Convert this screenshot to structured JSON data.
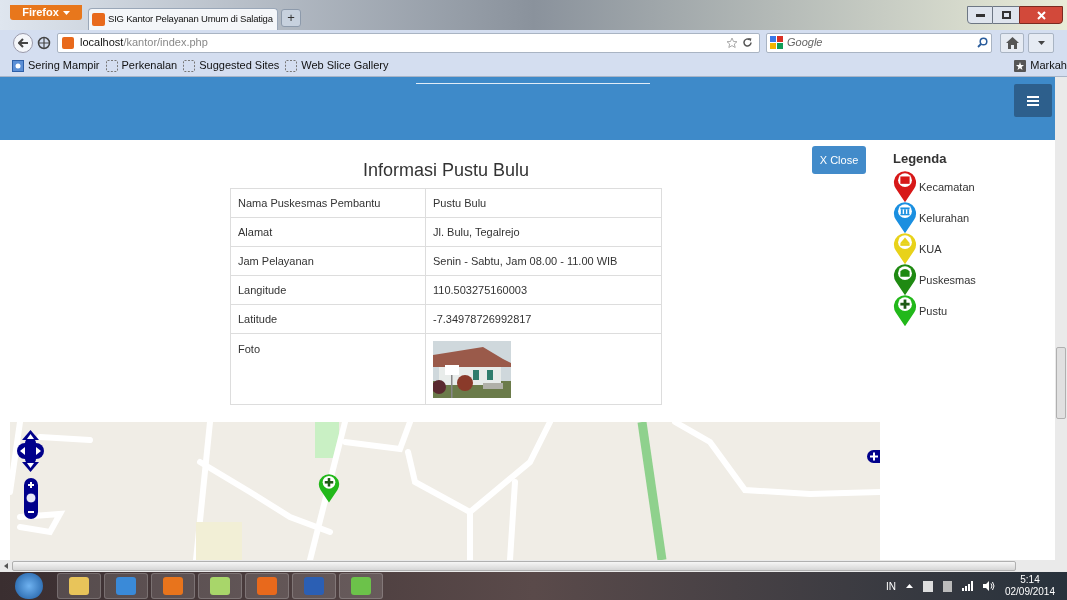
{
  "browser": {
    "menu_button": "Firefox",
    "tabs": [
      {
        "title": "SIG Kantor Pelayanan Umum di Salatiga",
        "selected": true
      }
    ],
    "new_tab": "+",
    "address": {
      "host": "localhost",
      "path": "/kantor/index.php"
    },
    "search": {
      "placeholder": "Google"
    },
    "bookmarks": [
      {
        "label": "Sering Mampir",
        "kind": "feed"
      },
      {
        "label": "Perkenalan",
        "kind": "page"
      },
      {
        "label": "Suggested Sites",
        "kind": "page"
      },
      {
        "label": "Web Slice Gallery",
        "kind": "page"
      }
    ],
    "bookmarks_menu": "Markah"
  },
  "page": {
    "close_button": "X Close",
    "info": {
      "title": "Informasi Pustu Bulu",
      "rows": [
        {
          "label": "Nama Puskesmas Pembantu",
          "value": "Pustu Bulu"
        },
        {
          "label": "Alamat",
          "value": "Jl. Bulu, Tegalrejo"
        },
        {
          "label": "Jam Pelayanan",
          "value": "Senin - Sabtu, Jam 08.00 - 11.00 WIB"
        },
        {
          "label": "Langitude",
          "value": "110.503275160003"
        },
        {
          "label": "Latitude",
          "value": "-7.34978726992817"
        }
      ],
      "photo": {
        "label": "Foto",
        "kind": "picture"
      }
    },
    "legend": {
      "title": "Legenda",
      "items": [
        {
          "label": "Kecamatan",
          "color": "#d71818",
          "kind": "office"
        },
        {
          "label": "Kelurahan",
          "color": "#1a8fe0",
          "kind": "hall"
        },
        {
          "label": "KUA",
          "color": "#e8d21a",
          "kind": "mosque"
        },
        {
          "label": "Puskesmas",
          "color": "#1f8a12",
          "kind": "clinic"
        },
        {
          "label": "Pustu",
          "color": "#22b81a",
          "kind": "plus"
        }
      ]
    }
  },
  "taskbar": {
    "language": "IN",
    "time": "5:14",
    "date": "02/09/2014"
  }
}
